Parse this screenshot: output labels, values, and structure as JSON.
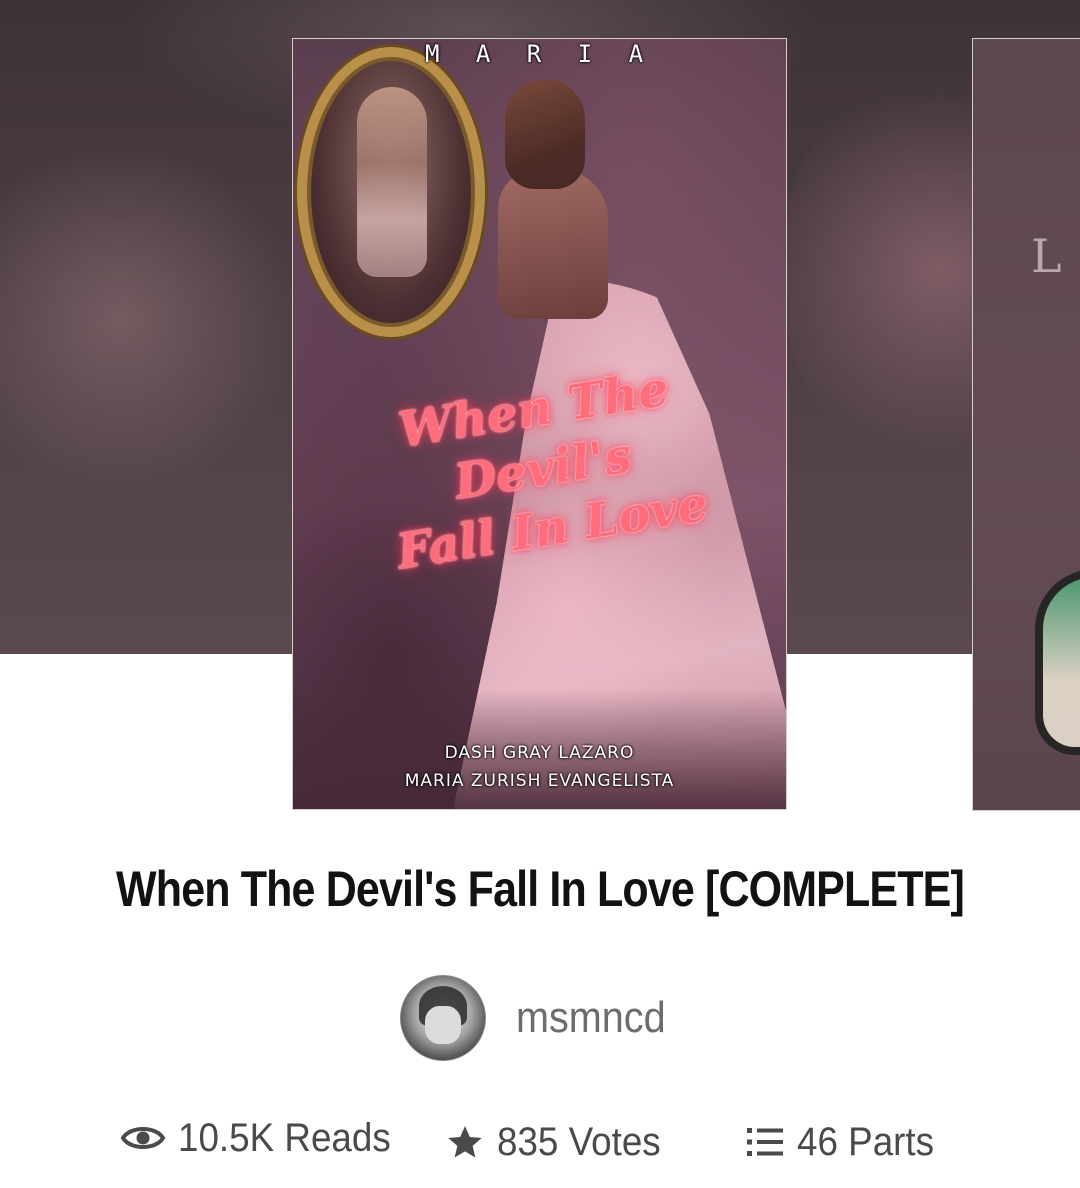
{
  "cover": {
    "top_text": "M A R I A",
    "title_line1": "When The Devil's",
    "title_line2": "Fall In Love",
    "author_line1": "DASH GRAY LAZARO",
    "author_line2": "MARIA ZURISH EVANGELISTA"
  },
  "next_cover": {
    "peek_text": "L"
  },
  "story": {
    "title": "When The Devil's Fall In Love [COMPLETE]",
    "author": "msmncd"
  },
  "stats": {
    "reads": "10.5K Reads",
    "votes": "835 Votes",
    "parts": "46 Parts"
  },
  "icons": {
    "reads": "eye-icon",
    "votes": "star-icon",
    "parts": "list-icon"
  },
  "colors": {
    "title_text": "#121212",
    "author_text": "#6c6c6c",
    "stats_text": "#4a4a4a",
    "cover_title_glow": "#ff6d7c"
  }
}
